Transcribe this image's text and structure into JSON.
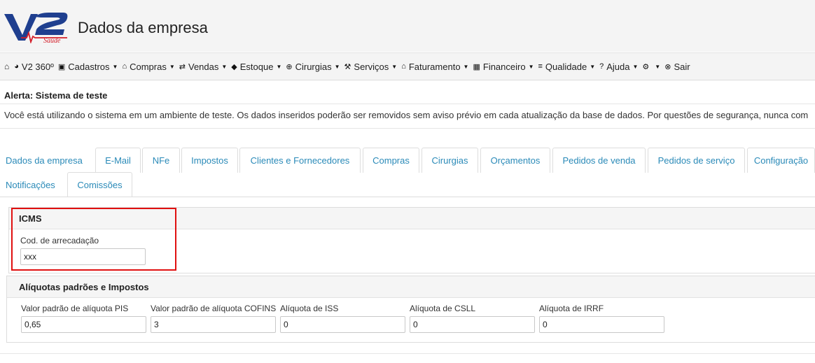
{
  "header": {
    "title": "Dados da empresa",
    "logo_text": "V2 Saúde"
  },
  "navbar": {
    "home_icon": "home-icon",
    "items": [
      {
        "label": "V2 360º",
        "icon": "pie-chart-icon",
        "caret": false
      },
      {
        "label": "Cadastros",
        "icon": "form-icon",
        "caret": true
      },
      {
        "label": "Compras",
        "icon": "bank-icon",
        "caret": true
      },
      {
        "label": "Vendas",
        "icon": "swap-icon",
        "caret": true
      },
      {
        "label": "Estoque",
        "icon": "tag-icon",
        "caret": true
      },
      {
        "label": "Cirurgias",
        "icon": "plus-circle-icon",
        "caret": true
      },
      {
        "label": "Serviços",
        "icon": "wrench-icon",
        "caret": true
      },
      {
        "label": "Faturamento",
        "icon": "bank-icon",
        "caret": true
      },
      {
        "label": "Financeiro",
        "icon": "calculator-icon",
        "caret": true
      },
      {
        "label": "Qualidade",
        "icon": "list-icon",
        "caret": true
      },
      {
        "label": "Ajuda",
        "icon": "question-icon",
        "caret": true
      },
      {
        "label": "",
        "icon": "gear-icon",
        "caret": true
      },
      {
        "label": "Sair",
        "icon": "close-circle-icon",
        "caret": false
      }
    ]
  },
  "alert": {
    "title": "Alerta: Sistema de teste",
    "text": "Você está utilizando o sistema em um ambiente de teste. Os dados inseridos poderão ser removidos sem aviso prévio em cada atualização da base de dados. Por questões de segurança, nunca com"
  },
  "tabs": [
    "Dados da empresa",
    "E-Mail",
    "NFe",
    "Impostos",
    "Clientes e Fornecedores",
    "Compras",
    "Cirurgias",
    "Orçamentos",
    "Pedidos de venda",
    "Pedidos de serviço",
    "Configuração",
    "Notificações",
    "Comissões"
  ],
  "active_tab": "Impostos",
  "icms": {
    "heading": "ICMS",
    "cod_label": "Cod. de arrecadação",
    "cod_value": "xxx"
  },
  "aliquotas": {
    "heading": "Alíquotas padrões e Impostos",
    "fields": [
      {
        "label": "Valor padrão de alíquota PIS",
        "value": "0,65"
      },
      {
        "label": "Valor padrão de alíquota COFINS",
        "value": "3"
      },
      {
        "label": "Alíquota de ISS",
        "value": "0"
      },
      {
        "label": "Alíquota de CSLL",
        "value": "0"
      },
      {
        "label": "Alíquota de IRRF",
        "value": "0"
      }
    ]
  },
  "colors": {
    "link": "#2a8ab8",
    "highlight": "#e01010",
    "logo_blue": "#1f3f8f",
    "logo_red": "#d41f2a"
  }
}
